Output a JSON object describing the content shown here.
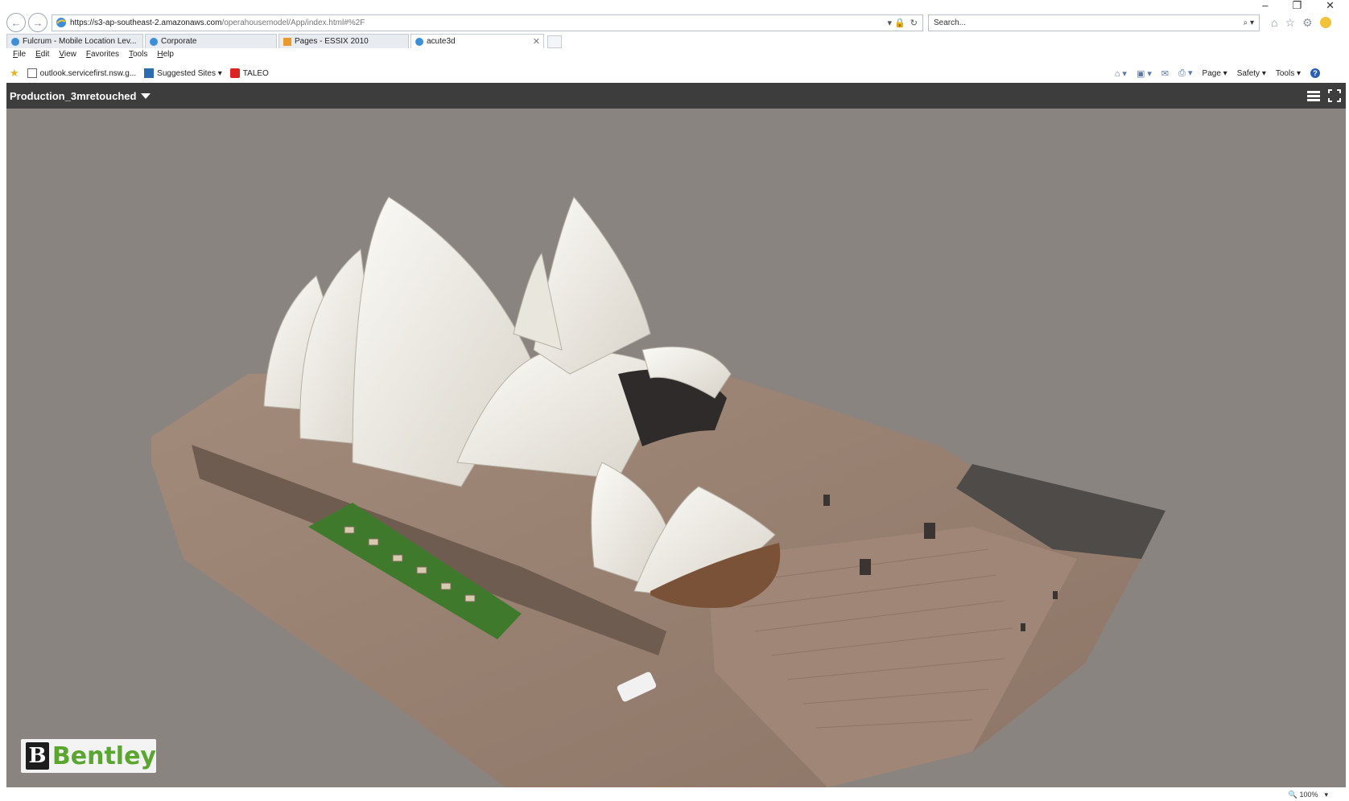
{
  "window": {
    "min_glyph": "–",
    "max_glyph": "❐",
    "close_glyph": "✕"
  },
  "address_bar": {
    "url_main": "https://s3-ap-southeast-2.amazonaws.com",
    "url_rest": "/operahousemodel/App/index.html#%2F",
    "search_placeholder": "Search...",
    "refresh_glyph": "↻",
    "lock_glyph": "▾ 🔒",
    "search_glyph": "⌕ ▾",
    "icons": [
      "home-icon",
      "favorites-star-icon",
      "settings-gear-icon",
      "smiley-feedback-icon"
    ]
  },
  "tabs": [
    {
      "label": "Fulcrum - Mobile Location Lev...",
      "icon": "ie-page-icon",
      "active": false
    },
    {
      "label": "Corporate",
      "icon": "ie-page-icon",
      "active": false
    },
    {
      "label": "Pages - ESSIX 2010",
      "icon": "sharepoint-icon",
      "active": false
    },
    {
      "label": "acute3d",
      "icon": "ie-page-icon",
      "active": true,
      "close": "✕"
    }
  ],
  "menu": [
    "File",
    "Edit",
    "View",
    "Favorites",
    "Tools",
    "Help"
  ],
  "favorites": [
    {
      "label": "outlook.servicefirst.nsw.g...",
      "icon": "page-icon"
    },
    {
      "label": "Suggested Sites ▾",
      "icon": "bing-icon"
    },
    {
      "label": "TALEO",
      "icon": "taleo-icon"
    }
  ],
  "command_bar": {
    "page": "Page ▾",
    "safety": "Safety ▾",
    "tools": "Tools ▾",
    "help": "?"
  },
  "viewer": {
    "model_title": "Production_3mretouched",
    "logo_mark": "B",
    "logo_word": "Bentley",
    "background": "#8a8481",
    "toolbar_bg": "#3d3d3d"
  },
  "status_bar": {
    "zoom": "🔍 100%",
    "zoom_caret": "▾"
  },
  "colors": {
    "bentley_green": "#5aa631",
    "shell_white": "#f1efea",
    "lawn_green": "#3f7a2c",
    "plaza": "#9c8474"
  }
}
